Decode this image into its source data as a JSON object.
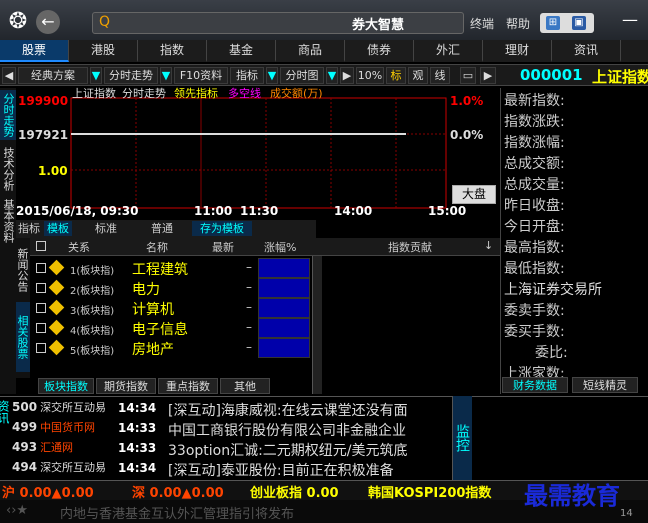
{
  "title": {
    "app": "券大智慧",
    "menu": [
      "终端",
      "帮助"
    ]
  },
  "main_tabs": [
    "股票",
    "港股",
    "指数",
    "基金",
    "商品",
    "债券",
    "外汇",
    "理财",
    "资讯"
  ],
  "toolbar": {
    "items": [
      "经典方案",
      "分时走势",
      "F10资料",
      "指标",
      "分时图",
      "10%",
      "标",
      "观",
      "线"
    ],
    "stock_code": "000001",
    "stock_name": "上证指数"
  },
  "left_tabs": [
    "分时走势",
    "技术分析",
    "基本资料"
  ],
  "chart": {
    "header": [
      "上证指数",
      "分时走势",
      "领先指标",
      "多空线",
      "成交额(万)"
    ],
    "y_labels": [
      "199900",
      "197921",
      "1.00"
    ],
    "pct_labels": [
      "1.0%",
      "0.0%"
    ],
    "big_button": "大盘",
    "date": "2015/06/18, 09:30",
    "time_ticks": [
      "11:00",
      "11:30",
      "14:00",
      "15:00"
    ]
  },
  "chart_data": {
    "type": "line",
    "y_ticks": [
      199900,
      197921,
      1.0
    ],
    "pct_ticks": [
      "1.0%",
      "0.0%"
    ],
    "x_ticks": [
      "09:30",
      "11:00",
      "11:30",
      "14:00",
      "15:00"
    ],
    "series": [
      {
        "values": [
          197921,
          197921
        ]
      }
    ]
  },
  "info_panel": {
    "rows": [
      "最新指数:",
      "指数涨跌:",
      "指数涨幅:",
      "总成交额:",
      "总成交量:",
      "昨日收盘:",
      "今日开盘:",
      "最高指数:",
      "最低指数:",
      "上海证券交易所",
      "委卖手数:",
      "委买手数:",
      "委比:",
      "上涨家数:"
    ],
    "tabs": [
      "财务数据",
      "短线精灵"
    ]
  },
  "subtabs": [
    "指标",
    "模板",
    "标准",
    "普通",
    "存为模板"
  ],
  "table": {
    "headers": [
      "关系",
      "名称",
      "最新",
      "涨幅%",
      "指数贡献"
    ],
    "rows": [
      {
        "idx": "1(板块指)",
        "name": "工程建筑",
        "latest": "–"
      },
      {
        "idx": "2(板块指)",
        "name": "电力",
        "latest": "–"
      },
      {
        "idx": "3(板块指)",
        "name": "计算机",
        "latest": "–"
      },
      {
        "idx": "4(板块指)",
        "name": "电子信息",
        "latest": "–"
      },
      {
        "idx": "5(板块指)",
        "name": "房地产",
        "latest": "–"
      }
    ],
    "side_tabs": [
      "新闻公告",
      "全屏",
      "分时成交",
      "相关股票",
      "其他"
    ]
  },
  "bottom_tabs": [
    "板块指数",
    "期货指数",
    "重点指数",
    "其他"
  ],
  "news": {
    "rows": [
      {
        "num": "500",
        "src": "深交所互动易",
        "time": "14:34",
        "text": "[深互动]海康威视:在线云课堂还没有面"
      },
      {
        "num": "499",
        "src": "中国货币网",
        "time": "14:33",
        "text": "中国工商银行股份有限公司非金融企业"
      },
      {
        "num": "493",
        "src": "汇通网",
        "time": "14:33",
        "text": "33option汇诚:二元期权纽元/美元筑底"
      },
      {
        "num": "494",
        "src": "深交所互动易",
        "time": "14:34",
        "text": "[深互动]泰亚股份:目前正在积极准备"
      }
    ],
    "side": "监控",
    "left": "资讯"
  },
  "status": {
    "sh": "沪 0.00▲0.00",
    "sz": "深 0.00▲0.00",
    "cy": "创业板指 0.00",
    "kr": "韩国KOSPI200指数"
  },
  "footer": {
    "text": "内地与香港基金互认外汇管理指引将发布"
  },
  "watermark": {
    "text": "最需教育",
    "sub": "14"
  }
}
